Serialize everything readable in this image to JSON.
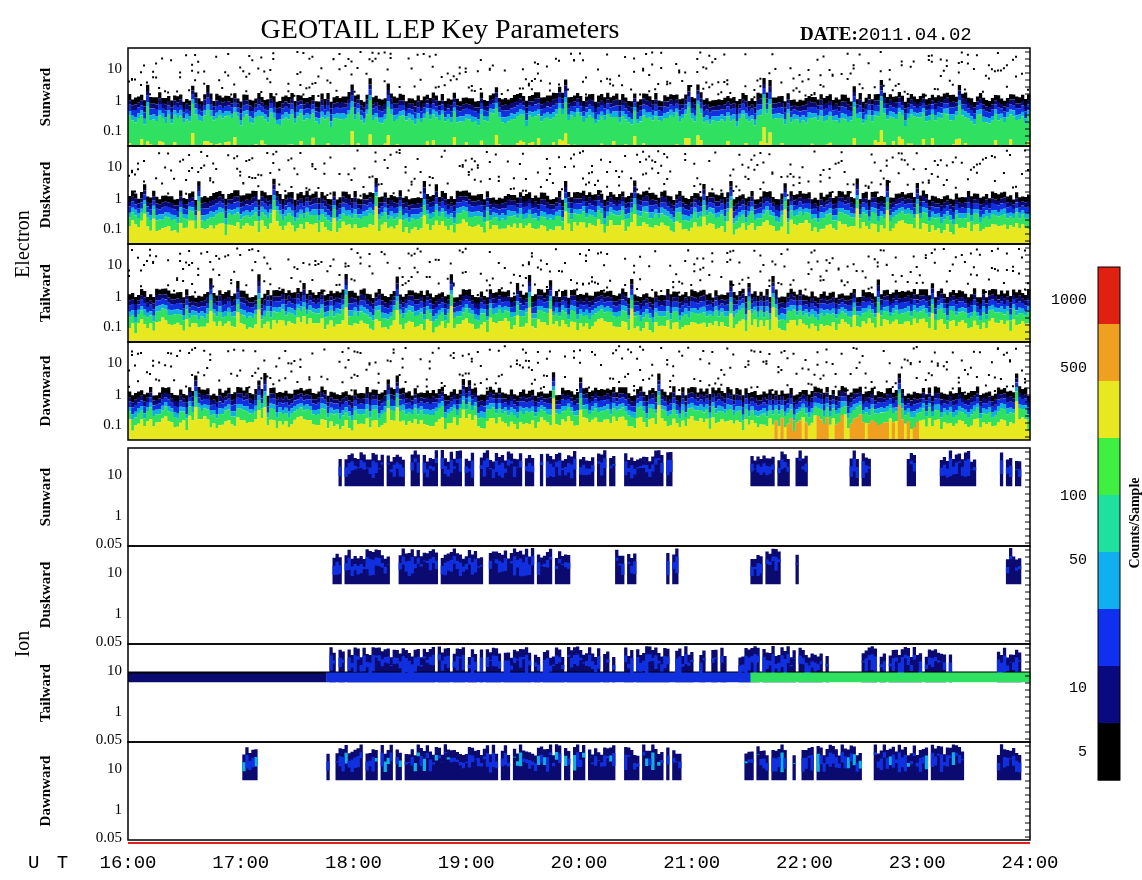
{
  "title": "GEOTAIL LEP Key Parameters",
  "date": {
    "label": "DATE:",
    "value": "2011.04.02"
  },
  "groups": [
    {
      "label": "Electron",
      "kind": "electron",
      "panels": [
        {
          "label": "Sunward",
          "yticks": [
            "10",
            "1",
            "0.1"
          ]
        },
        {
          "label": "Duskward",
          "yticks": [
            "10",
            "1",
            "0.1"
          ]
        },
        {
          "label": "Tailward",
          "yticks": [
            "10",
            "1",
            "0.1"
          ]
        },
        {
          "label": "Dawnward",
          "yticks": [
            "10",
            "1",
            "0.1"
          ]
        }
      ]
    },
    {
      "label": "Ion",
      "kind": "ion",
      "panels": [
        {
          "label": "Sunward",
          "yticks": [
            "10",
            "1",
            "0.05"
          ]
        },
        {
          "label": "Duskward",
          "yticks": [
            "10",
            "1",
            "0.05"
          ]
        },
        {
          "label": "Tailward",
          "yticks": [
            "10",
            "1",
            "0.05"
          ]
        },
        {
          "label": "Dawnward",
          "yticks": [
            "10",
            "1",
            "0.05"
          ]
        }
      ]
    }
  ],
  "x_axis": {
    "label": "U T",
    "ticks": [
      "16:00",
      "17:00",
      "18:00",
      "19:00",
      "20:00",
      "21:00",
      "22:00",
      "23:00",
      "24:00"
    ]
  },
  "colorbar": {
    "label": "Counts/Sample",
    "ticks": [
      "1000",
      "500",
      "100",
      "50",
      "10",
      "5"
    ]
  }
}
